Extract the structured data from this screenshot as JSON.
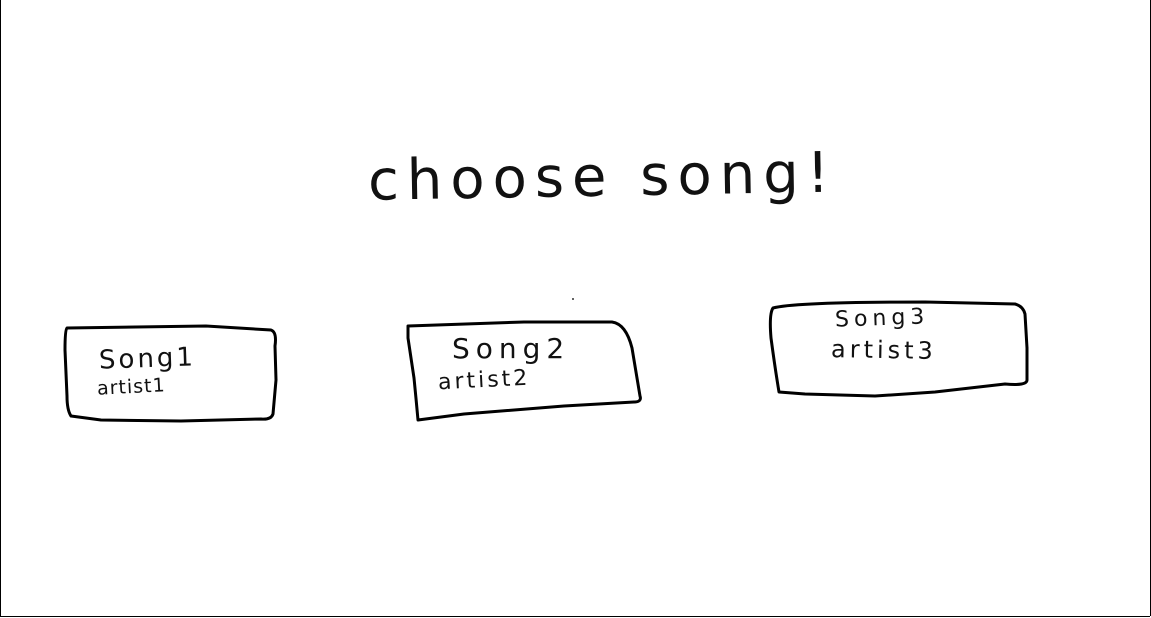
{
  "page": {
    "title": "choose song!"
  },
  "songs": [
    {
      "song": "Song1",
      "artist": "artist1"
    },
    {
      "song": "Song2",
      "artist": "artist2"
    },
    {
      "song": "Song3",
      "artist": "artist3"
    }
  ],
  "colors": {
    "background": "#ffffff",
    "stroke": "#000000"
  }
}
